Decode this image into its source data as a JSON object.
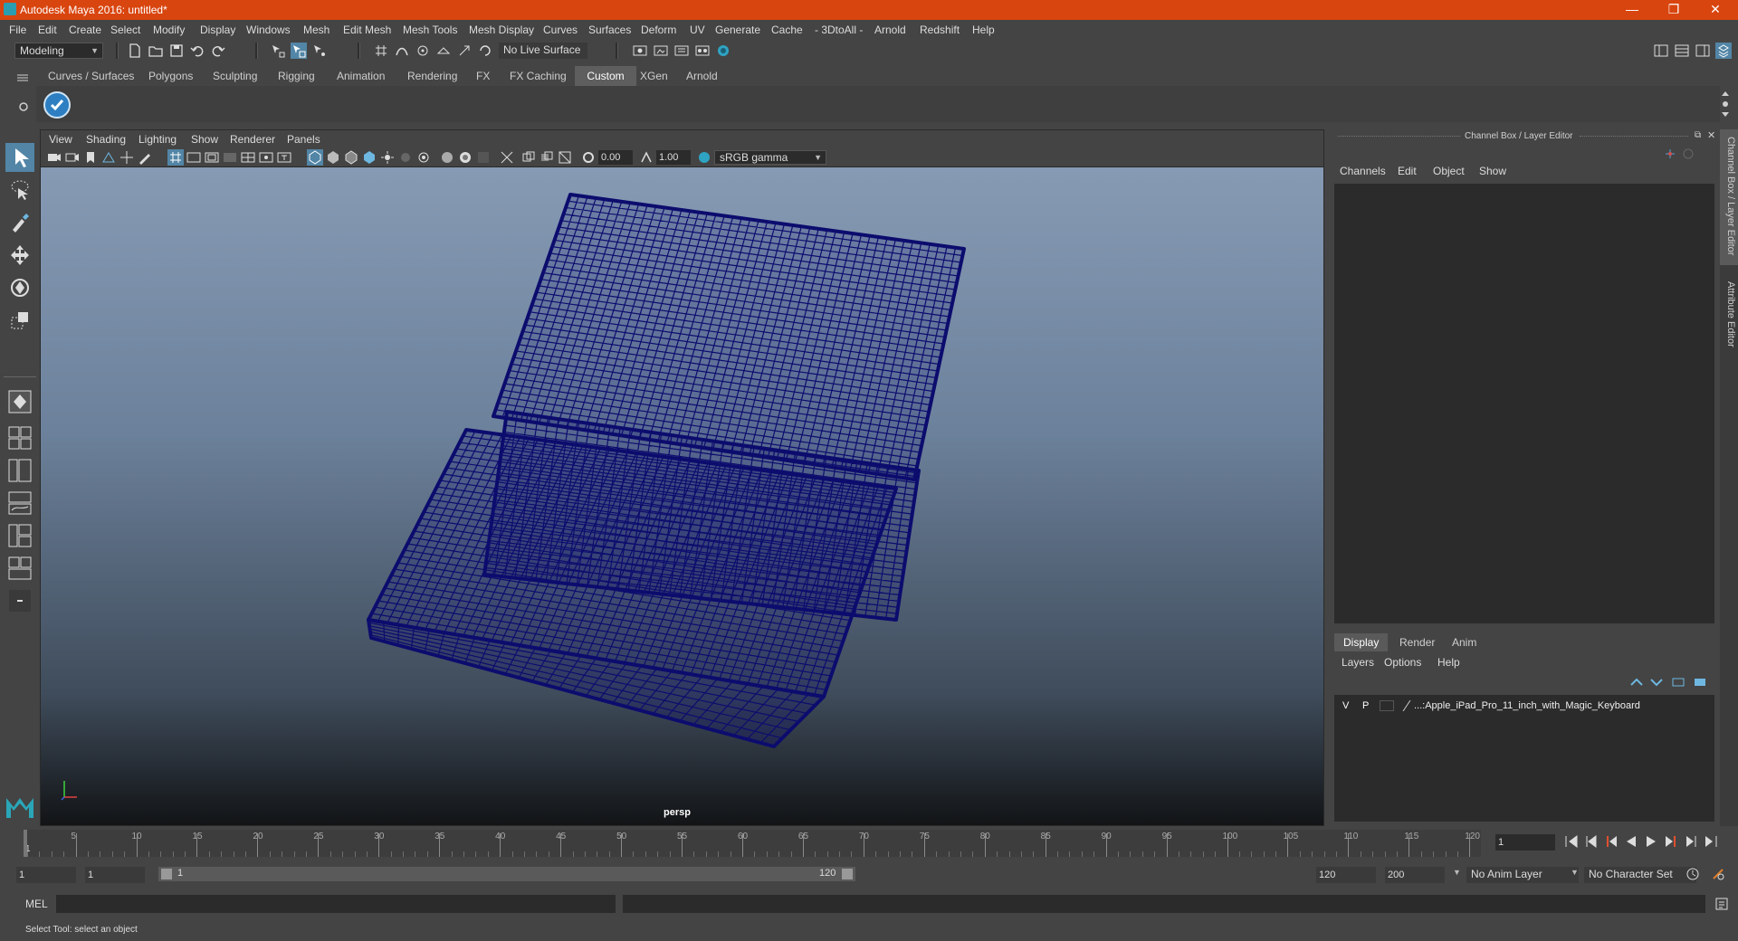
{
  "window": {
    "title": "Autodesk Maya 2016: untitled*",
    "controls": {
      "minimize": "—",
      "restore": "❐",
      "close": "✕"
    }
  },
  "menubar": [
    "File",
    "Edit",
    "Create",
    "Select",
    "Modify",
    "Display",
    "Windows",
    "Mesh",
    "Edit Mesh",
    "Mesh Tools",
    "Mesh Display",
    "Curves",
    "Surfaces",
    "Deform",
    "UV",
    "Generate",
    "Cache",
    "- 3DtoAll -",
    "Arnold",
    "Redshift",
    "Help"
  ],
  "statusline": {
    "mode": "Modeling",
    "live_surface": "No Live Surface"
  },
  "shelf": {
    "tabs": [
      "Curves / Surfaces",
      "Polygons",
      "Sculpting",
      "Rigging",
      "Animation",
      "Rendering",
      "FX",
      "FX Caching",
      "Custom",
      "XGen",
      "Arnold"
    ],
    "active_tab": "Custom"
  },
  "viewport": {
    "menu": [
      "View",
      "Shading",
      "Lighting",
      "Show",
      "Renderer",
      "Panels"
    ],
    "exposure": "0.00",
    "gamma": "1.00",
    "color_space": "sRGB gamma",
    "camera_label": "persp",
    "wire_color": "#0c0c6e"
  },
  "right_panel": {
    "title": "Channel Box / Layer Editor",
    "channel_menu": [
      "Channels",
      "Edit",
      "Object",
      "Show"
    ],
    "layer_tabs": [
      "Display",
      "Render",
      "Anim"
    ],
    "active_layer_tab": "Display",
    "layer_menu": [
      "Layers",
      "Options",
      "Help"
    ],
    "layer": {
      "v": "V",
      "p": "P",
      "name": "...:Apple_iPad_Pro_11_inch_with_Magic_Keyboard"
    },
    "side_tabs": [
      "Channel Box / Layer Editor",
      "Attribute Editor"
    ]
  },
  "timeslider": {
    "start_marker": "1",
    "ticks": [
      "5",
      "10",
      "15",
      "20",
      "25",
      "30",
      "35",
      "40",
      "45",
      "50",
      "55",
      "60",
      "65",
      "70",
      "75",
      "80",
      "85",
      "90",
      "95",
      "100",
      "105",
      "110",
      "115",
      "120"
    ],
    "current_frame": "1"
  },
  "range": {
    "start": "1",
    "playback_start": "1",
    "slider_start": "1",
    "slider_end": "120",
    "playback_end": "120",
    "end": "200",
    "anim_layer": "No Anim Layer",
    "character_set": "No Character Set"
  },
  "command": {
    "language": "MEL"
  },
  "help_line": "Select Tool: select an object"
}
